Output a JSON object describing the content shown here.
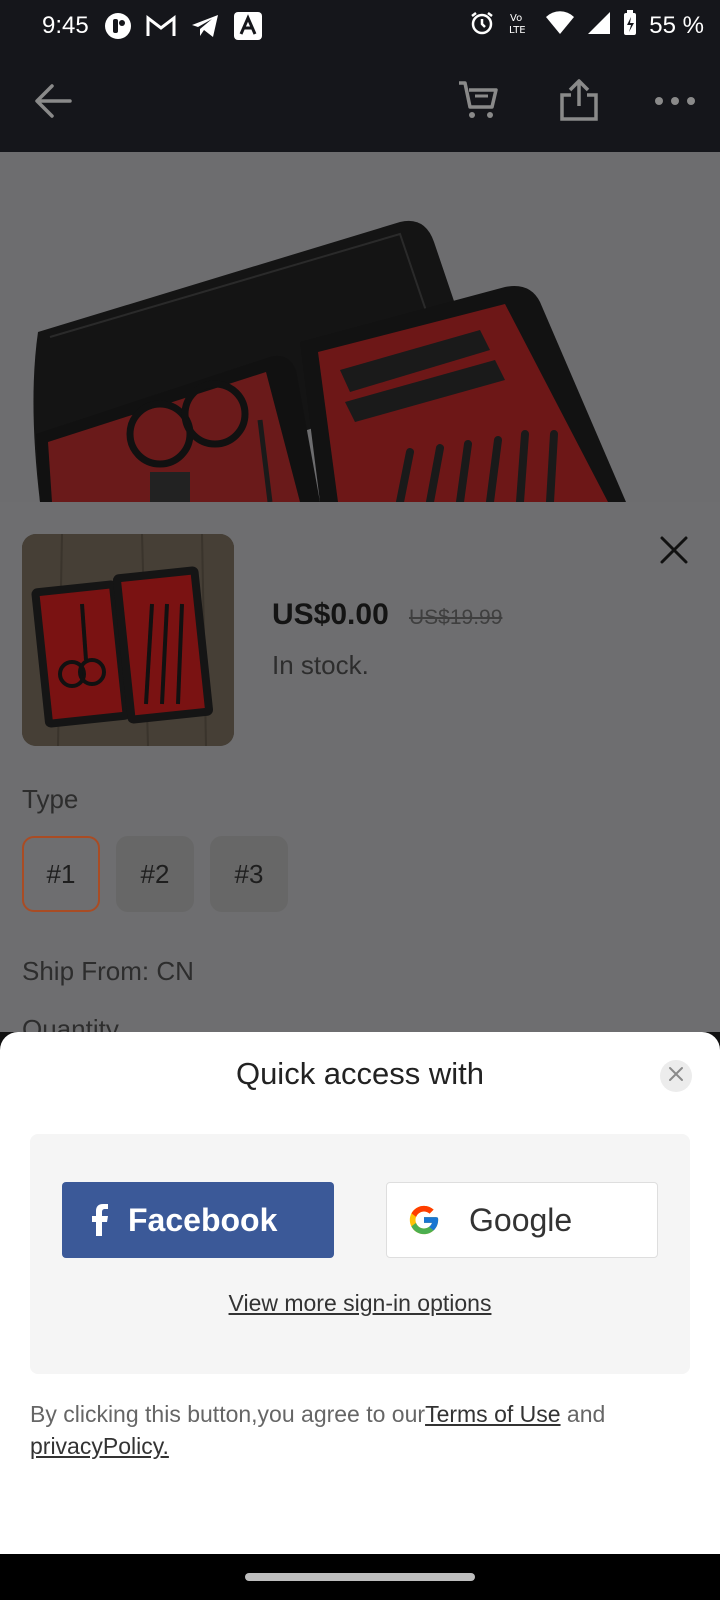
{
  "status_bar": {
    "time": "9:45",
    "battery": "55 %",
    "left_icons": [
      "notification-app-icon",
      "gmail-icon",
      "telegram-icon",
      "app-a-icon"
    ],
    "right_icons": [
      "alarm-icon",
      "volte-icon",
      "wifi-icon",
      "signal-icon",
      "battery-icon"
    ]
  },
  "app_bar": {
    "icons": [
      "back-arrow-icon",
      "cart-icon",
      "share-icon",
      "more-icon"
    ]
  },
  "product": {
    "price": "US$0.00",
    "original_price": "US$19.99",
    "stock": "In stock.",
    "type_label": "Type",
    "types": [
      "#1",
      "#2",
      "#3"
    ],
    "selected_type": "#1",
    "ship_from": "Ship From: CN",
    "quantity_label": "Quantity"
  },
  "sheet": {
    "title": "Quick access with",
    "facebook_label": "Facebook",
    "google_label": "Google",
    "more_options": "View more sign-in options",
    "legal_prefix": "By clicking this button,you agree to our",
    "terms_link": "Terms of Use",
    "legal_and": " and",
    "privacy_link": "privacyPolicy."
  },
  "colors": {
    "facebook_blue": "#3b5998",
    "selected_chip_border": "#a94c24",
    "appbar_bg": "#15161b",
    "dim_overlay": "#6e6e70"
  }
}
